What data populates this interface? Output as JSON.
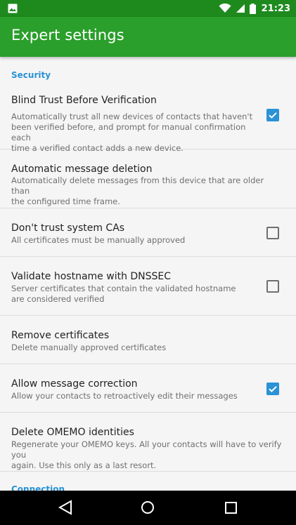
{
  "status_bar": {
    "time": "21:23",
    "icons": [
      "image-icon",
      "wifi-icon",
      "cell-signal-icon",
      "battery-icon"
    ]
  },
  "app_bar": {
    "title": "Expert settings"
  },
  "sections": {
    "security": "Security",
    "connection": "Connection"
  },
  "prefs": [
    {
      "title": "Blind Trust Before Verification",
      "summary": [
        "Automatically trust all new devices of contacts that haven't",
        "been verified before, and prompt for manual confirmation each",
        "time a verified contact adds a new device."
      ],
      "checked": true
    },
    {
      "title": "Automatic message deletion",
      "summary": [
        "Automatically delete messages from this device that are older than",
        "the configured time frame."
      ]
    },
    {
      "title": "Don't trust system CAs",
      "summary": [
        "All certificates must be manually approved"
      ],
      "checked": false
    },
    {
      "title": "Validate hostname with DNSSEC",
      "summary": [
        "Server certificates that contain the validated hostname",
        "are considered verified"
      ],
      "checked": false
    },
    {
      "title": "Remove certificates",
      "summary": [
        "Delete manually approved certificates"
      ]
    },
    {
      "title": "Allow message correction",
      "summary": [
        "Allow your contacts to retroactively edit their messages"
      ],
      "checked": true
    },
    {
      "title": "Delete OMEMO identities",
      "summary": [
        "Regenerate your OMEMO keys. All your contacts will have to verify you",
        "again. Use this only as a last resort."
      ]
    }
  ],
  "colors": {
    "status_bar": "#1e8a1e",
    "app_bar": "#2a9f2b",
    "accent": "#2a92d5",
    "nav_bar": "#000000"
  }
}
